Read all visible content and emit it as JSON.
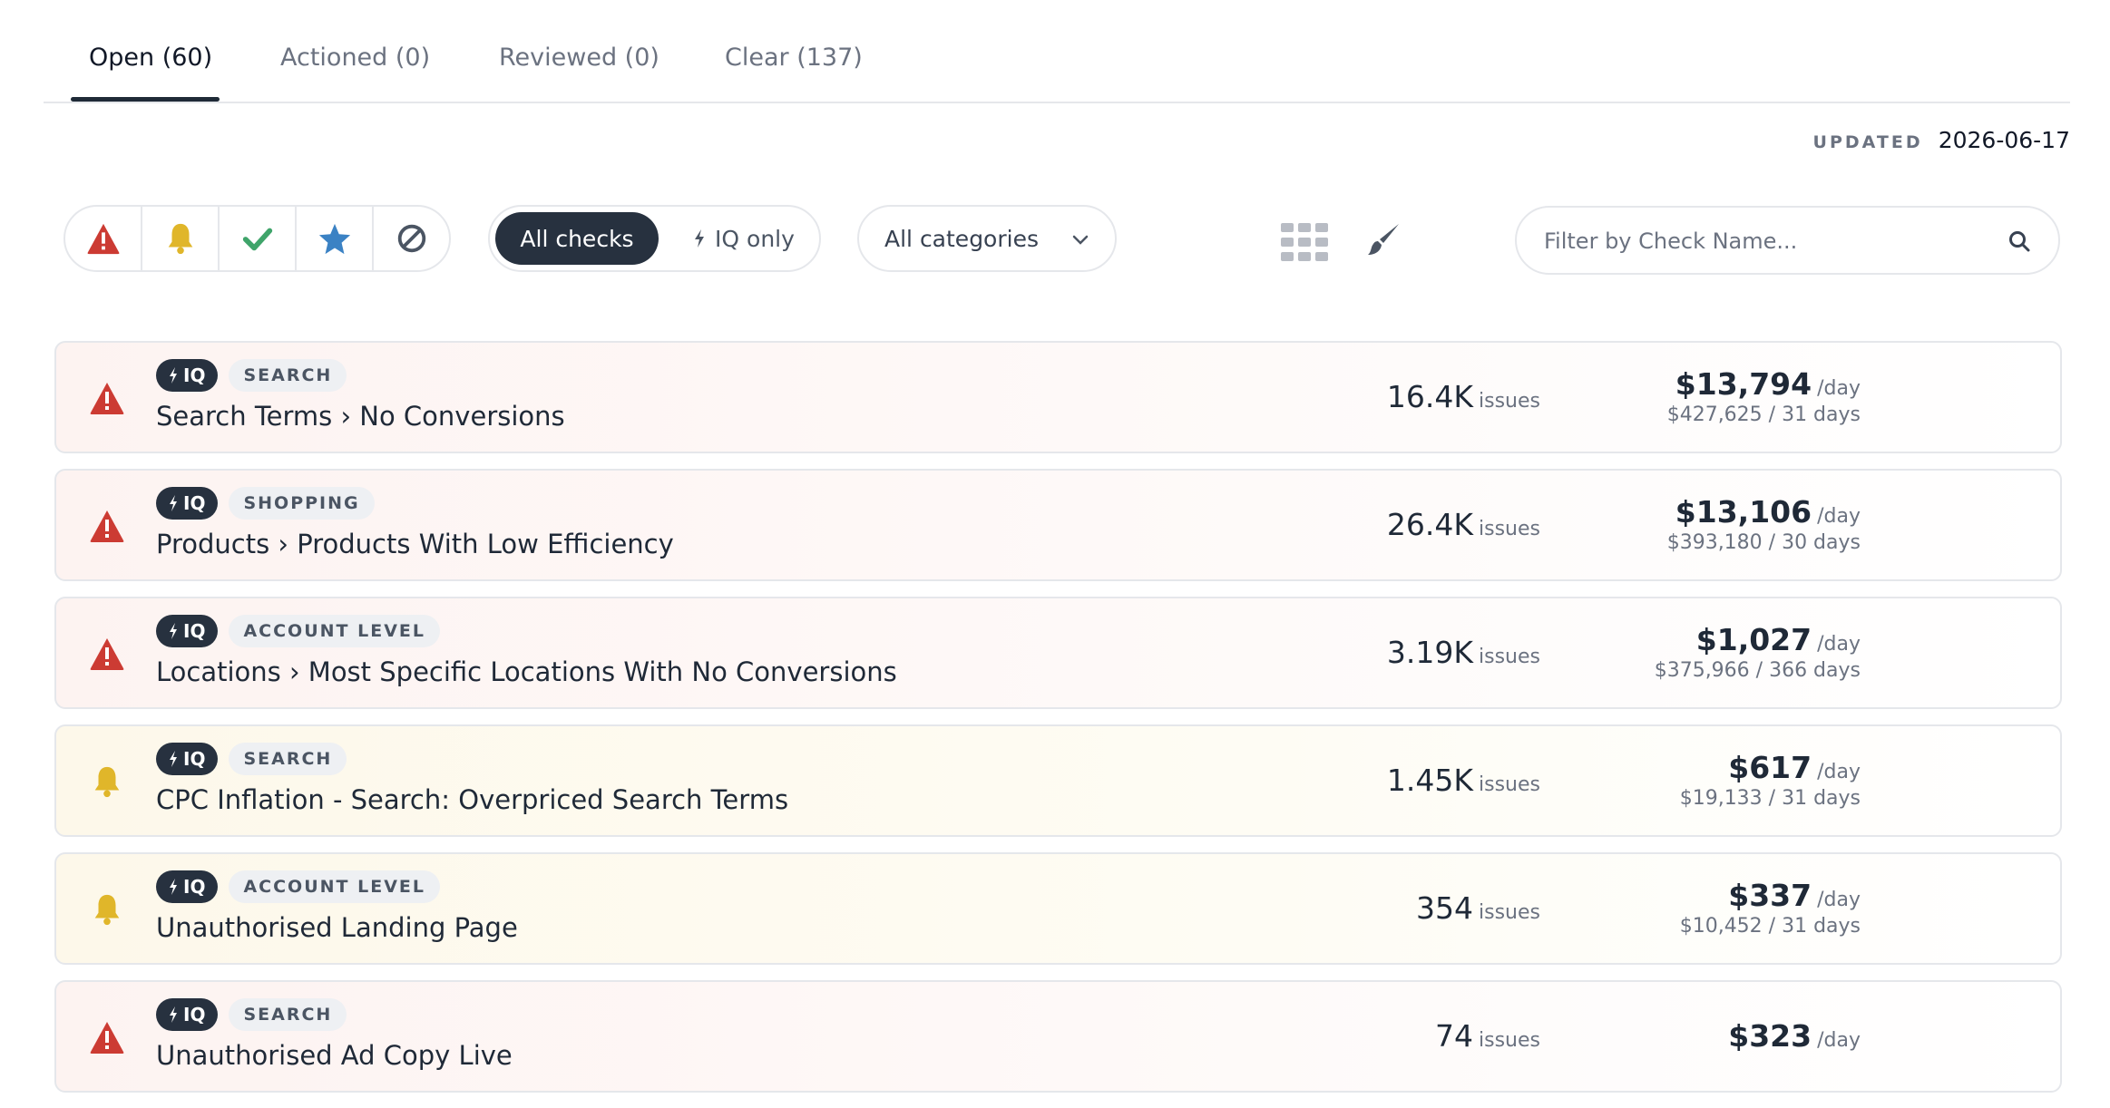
{
  "tabs": [
    {
      "label": "Open (60)",
      "active": true
    },
    {
      "label": "Actioned (0)",
      "active": false
    },
    {
      "label": "Reviewed (0)",
      "active": false
    },
    {
      "label": "Clear (137)",
      "active": false
    }
  ],
  "updated": {
    "label": "UPDATED",
    "date": "2026-06-17"
  },
  "filters": {
    "severity_buttons": [
      "warning-triangle-icon",
      "bell-icon",
      "checkmark-icon",
      "star-icon",
      "ban-icon"
    ],
    "all_checks": "All checks",
    "iq_only": "IQ only",
    "category": "All categories",
    "search_placeholder": "Filter by Check Name..."
  },
  "colors": {
    "critical": "#cc3b33",
    "warning": "#e0b62a",
    "success": "#3fa46a",
    "star": "#3b82c4",
    "dark": "#27313f"
  },
  "rows": [
    {
      "severity": "critical",
      "iq": "IQ",
      "category": "SEARCH",
      "title": "Search Terms › No Conversions",
      "issues": "16.4K",
      "issues_unit": "issues",
      "per_day": "$13,794",
      "per_day_unit": "/day",
      "total": "$427,625 / 31 days"
    },
    {
      "severity": "critical",
      "iq": "IQ",
      "category": "SHOPPING",
      "title": "Products › Products With Low Efficiency",
      "issues": "26.4K",
      "issues_unit": "issues",
      "per_day": "$13,106",
      "per_day_unit": "/day",
      "total": "$393,180 / 30 days"
    },
    {
      "severity": "critical",
      "iq": "IQ",
      "category": "ACCOUNT LEVEL",
      "title": "Locations › Most Specific Locations With No Conversions",
      "issues": "3.19K",
      "issues_unit": "issues",
      "per_day": "$1,027",
      "per_day_unit": "/day",
      "total": "$375,966 / 366 days"
    },
    {
      "severity": "warning",
      "iq": "IQ",
      "category": "SEARCH",
      "title": "CPC Inflation - Search: Overpriced Search Terms",
      "issues": "1.45K",
      "issues_unit": "issues",
      "per_day": "$617",
      "per_day_unit": "/day",
      "total": "$19,133 / 31 days"
    },
    {
      "severity": "warning",
      "iq": "IQ",
      "category": "ACCOUNT LEVEL",
      "title": "Unauthorised Landing Page",
      "issues": "354",
      "issues_unit": "issues",
      "per_day": "$337",
      "per_day_unit": "/day",
      "total": "$10,452 / 31 days"
    },
    {
      "severity": "critical",
      "iq": "IQ",
      "category": "SEARCH",
      "title": "Unauthorised Ad Copy Live",
      "issues": "74",
      "issues_unit": "issues",
      "per_day": "$323",
      "per_day_unit": "/day",
      "total": ""
    }
  ]
}
